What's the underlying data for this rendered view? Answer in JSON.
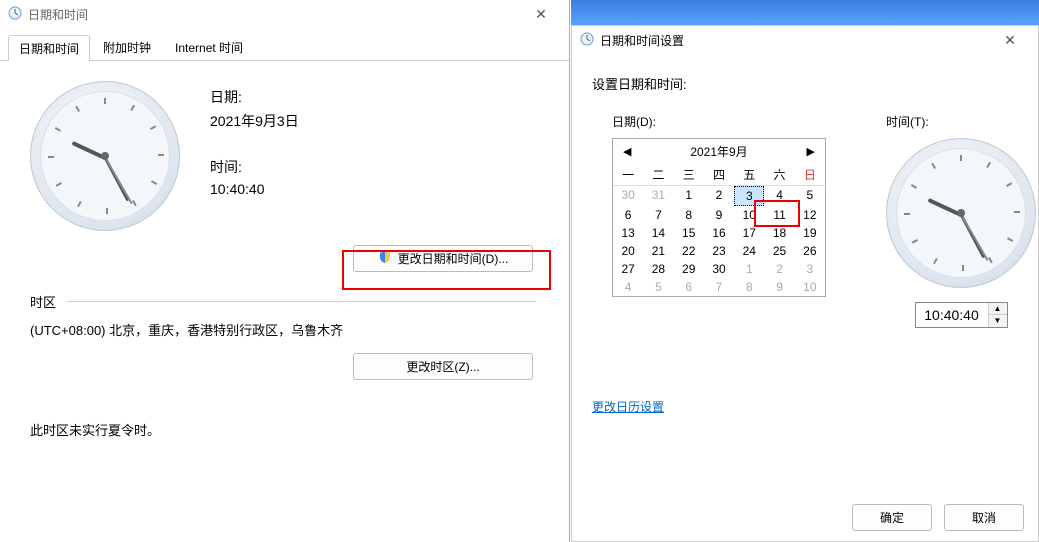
{
  "main": {
    "title": "日期和时间",
    "tabs": [
      "日期和时间",
      "附加时钟",
      "Internet 时间"
    ],
    "date_label": "日期:",
    "date_value": "2021年9月3日",
    "time_label": "时间:",
    "time_value": "10:40:40",
    "change_dt_btn": "更改日期和时间(D)...",
    "tz_heading": "时区",
    "tz_value": "(UTC+08:00) 北京，重庆，香港特别行政区，乌鲁木齐",
    "change_tz_btn": "更改时区(Z)...",
    "dst_note": "此时区未实行夏令时。",
    "clock": {
      "hour_angle": -65,
      "min_angle": 152,
      "sec_angle": 150
    }
  },
  "settings": {
    "title": "日期和时间设置",
    "heading": "设置日期和时间:",
    "date_label": "日期(D):",
    "time_label": "时间(T):",
    "month_title": "2021年9月",
    "weekdays": [
      "一",
      "二",
      "三",
      "四",
      "五",
      "六",
      "日"
    ],
    "days": [
      {
        "n": 30,
        "o": true
      },
      {
        "n": 31,
        "o": true
      },
      {
        "n": 1
      },
      {
        "n": 2
      },
      {
        "n": 3,
        "sel": true
      },
      {
        "n": 4
      },
      {
        "n": 5
      },
      {
        "n": 6
      },
      {
        "n": 7
      },
      {
        "n": 8
      },
      {
        "n": 9
      },
      {
        "n": 10
      },
      {
        "n": 11
      },
      {
        "n": 12
      },
      {
        "n": 13
      },
      {
        "n": 14
      },
      {
        "n": 15
      },
      {
        "n": 16
      },
      {
        "n": 17
      },
      {
        "n": 18
      },
      {
        "n": 19
      },
      {
        "n": 20
      },
      {
        "n": 21
      },
      {
        "n": 22
      },
      {
        "n": 23
      },
      {
        "n": 24
      },
      {
        "n": 25
      },
      {
        "n": 26
      },
      {
        "n": 27
      },
      {
        "n": 28
      },
      {
        "n": 29
      },
      {
        "n": 30
      },
      {
        "n": 1,
        "o": true
      },
      {
        "n": 2,
        "o": true
      },
      {
        "n": 3,
        "o": true
      },
      {
        "n": 4,
        "o": true
      },
      {
        "n": 5,
        "o": true
      },
      {
        "n": 6,
        "o": true
      },
      {
        "n": 7,
        "o": true
      },
      {
        "n": 8,
        "o": true
      },
      {
        "n": 9,
        "o": true
      },
      {
        "n": 10,
        "o": true
      }
    ],
    "time_value": "10:40:40",
    "cal_settings_link": "更改日历设置",
    "ok_btn": "确定",
    "cancel_btn": "取消",
    "clock": {
      "hour_angle": -65,
      "min_angle": 152,
      "sec_angle": 150
    }
  }
}
